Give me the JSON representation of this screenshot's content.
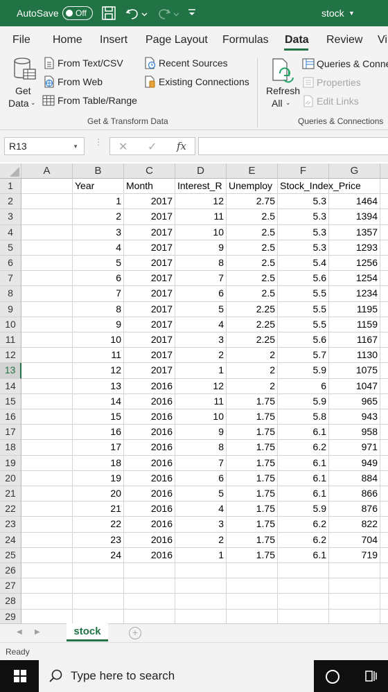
{
  "titlebar": {
    "autosave_label": "AutoSave",
    "autosave_state": "Off",
    "document_name": "stock"
  },
  "ribbon_tabs": [
    "File",
    "Home",
    "Insert",
    "Page Layout",
    "Formulas",
    "Data",
    "Review",
    "Vi"
  ],
  "active_tab": "Data",
  "ribbon": {
    "get_data_line1": "Get",
    "get_data_line2": "Data",
    "from_text_csv": "From Text/CSV",
    "from_web": "From Web",
    "from_table_range": "From Table/Range",
    "recent_sources": "Recent Sources",
    "existing_connections": "Existing Connections",
    "group1_label": "Get & Transform Data",
    "refresh_line1": "Refresh",
    "refresh_line2": "All",
    "queries_connections": "Queries & Conne",
    "properties": "Properties",
    "edit_links": "Edit Links",
    "group2_label": "Queries & Connections"
  },
  "formula_bar": {
    "name_box": "R13",
    "fx_label": "fx",
    "formula": ""
  },
  "columns": [
    "A",
    "B",
    "C",
    "D",
    "E",
    "F",
    "G"
  ],
  "header_row": [
    "",
    "Year",
    "Month",
    "Interest_R",
    "Unemploy",
    "Stock_Index_Price",
    ""
  ],
  "rows": [
    [
      1,
      2017,
      12,
      2.75,
      5.3,
      1464
    ],
    [
      2,
      2017,
      11,
      2.5,
      5.3,
      1394
    ],
    [
      3,
      2017,
      10,
      2.5,
      5.3,
      1357
    ],
    [
      4,
      2017,
      9,
      2.5,
      5.3,
      1293
    ],
    [
      5,
      2017,
      8,
      2.5,
      5.4,
      1256
    ],
    [
      6,
      2017,
      7,
      2.5,
      5.6,
      1254
    ],
    [
      7,
      2017,
      6,
      2.5,
      5.5,
      1234
    ],
    [
      8,
      2017,
      5,
      2.25,
      5.5,
      1195
    ],
    [
      9,
      2017,
      4,
      2.25,
      5.5,
      1159
    ],
    [
      10,
      2017,
      3,
      2.25,
      5.6,
      1167
    ],
    [
      11,
      2017,
      2,
      2,
      5.7,
      1130
    ],
    [
      12,
      2017,
      1,
      2,
      5.9,
      1075
    ],
    [
      13,
      2016,
      12,
      2,
      6,
      1047
    ],
    [
      14,
      2016,
      11,
      1.75,
      5.9,
      965
    ],
    [
      15,
      2016,
      10,
      1.75,
      5.8,
      943
    ],
    [
      16,
      2016,
      9,
      1.75,
      6.1,
      958
    ],
    [
      17,
      2016,
      8,
      1.75,
      6.2,
      971
    ],
    [
      18,
      2016,
      7,
      1.75,
      6.1,
      949
    ],
    [
      19,
      2016,
      6,
      1.75,
      6.1,
      884
    ],
    [
      20,
      2016,
      5,
      1.75,
      6.1,
      866
    ],
    [
      21,
      2016,
      4,
      1.75,
      5.9,
      876
    ],
    [
      22,
      2016,
      3,
      1.75,
      6.2,
      822
    ],
    [
      23,
      2016,
      2,
      1.75,
      6.2,
      704
    ],
    [
      24,
      2016,
      1,
      1.75,
      6.1,
      719
    ]
  ],
  "row_numbers": [
    1,
    2,
    3,
    4,
    5,
    6,
    7,
    8,
    9,
    10,
    11,
    12,
    13,
    14,
    15,
    16,
    17,
    18,
    19,
    20,
    21,
    22,
    23,
    24,
    25,
    26,
    27,
    28,
    29
  ],
  "selected_row": 13,
  "sheet_tab": "stock",
  "add_sheet_symbol": "+",
  "status": "Ready",
  "taskbar": {
    "search_placeholder": "Type here to search"
  },
  "colors": {
    "excel_green": "#217346",
    "taskbar": "#0f0f0f"
  },
  "icons": [
    "save-icon",
    "undo-icon",
    "redo-icon",
    "customize-qat-icon",
    "get-data-icon",
    "text-csv-icon",
    "web-icon",
    "table-icon",
    "recent-sources-icon",
    "existing-connections-icon",
    "refresh-all-icon",
    "queries-icon",
    "properties-icon",
    "edit-links-icon",
    "windows-logo-icon",
    "search-icon",
    "cortana-icon",
    "task-view-icon"
  ]
}
